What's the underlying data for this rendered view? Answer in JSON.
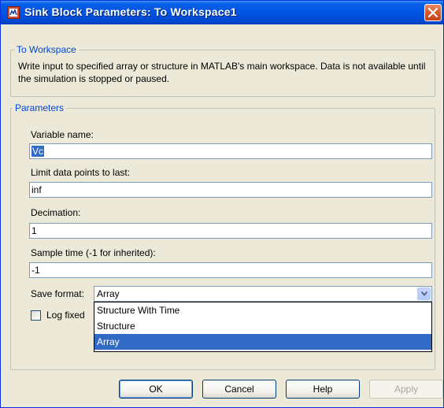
{
  "window": {
    "title": "Sink Block Parameters: To Workspace1",
    "icon": "simulink-block-icon",
    "close_icon": "close-icon"
  },
  "block_group": {
    "legend": "To Workspace",
    "description": "Write input to specified array or structure in MATLAB's main workspace. Data is not available until the simulation is stopped or paused."
  },
  "parameters": {
    "legend": "Parameters",
    "variable_name": {
      "label": "Variable name:",
      "value": "Vc"
    },
    "limit_points": {
      "label": "Limit data points to last:",
      "value": "inf"
    },
    "decimation": {
      "label": "Decimation:",
      "value": "1"
    },
    "sample_time": {
      "label": "Sample time (-1 for inherited):",
      "value": "-1"
    },
    "save_format": {
      "label": "Save format:",
      "value": "Array",
      "options": [
        "Structure With Time",
        "Structure",
        "Array"
      ],
      "highlighted": "Array"
    },
    "log_fixed": {
      "label": "Log fixed",
      "checked": false
    }
  },
  "buttons": {
    "ok": "OK",
    "cancel": "Cancel",
    "help": "Help",
    "apply": "Apply"
  },
  "colors": {
    "titlebar": "#0054e3",
    "dialog_bg": "#ece9d8",
    "selection": "#316ac5",
    "group_title": "#0046d5"
  }
}
